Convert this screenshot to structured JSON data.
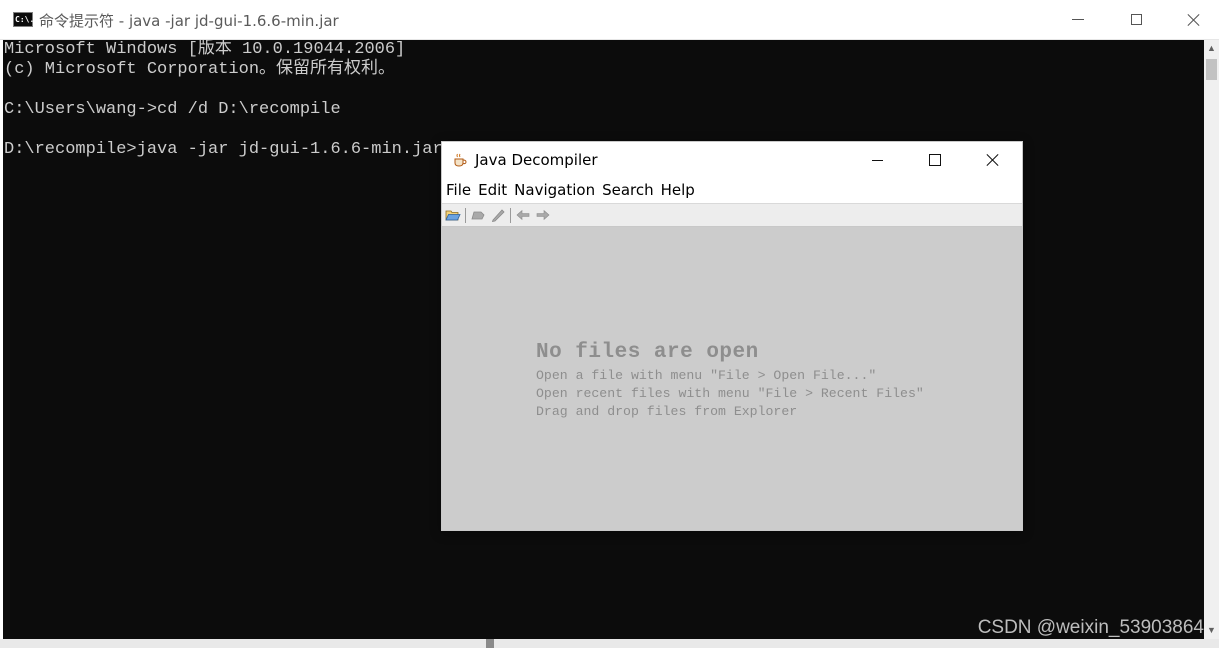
{
  "console_window": {
    "title": "命令提示符 - java  -jar jd-gui-1.6.6-min.jar",
    "icon": "cmd-icon",
    "icon_text": "C:\\.",
    "controls": {
      "minimize": "minimize-icon",
      "maximize": "maximize-icon",
      "close": "close-icon"
    },
    "lines": [
      "Microsoft Windows [版本 10.0.19044.2006]",
      "(c) Microsoft Corporation。保留所有权利。",
      "",
      "C:\\Users\\wang->cd /d D:\\recompile",
      "",
      "D:\\recompile>java -jar jd-gui-1.6.6-min.jar"
    ],
    "colors": {
      "background": "#0c0c0c",
      "text": "#cccccc"
    }
  },
  "watermark": "CSDN @weixin_53903864",
  "jd_window": {
    "title": "Java Decompiler",
    "icon": "coffee-cup-icon",
    "menu": [
      "File",
      "Edit",
      "Navigation",
      "Search",
      "Help"
    ],
    "toolbar": [
      "open-folder-icon",
      "open-type-icon",
      "search-pencil-icon",
      "back-arrow-icon",
      "forward-arrow-icon"
    ],
    "empty_state": {
      "title": "No files are open",
      "hints": [
        "Open a file with menu \"File > Open File...\"",
        "Open recent files with menu \"File > Recent Files\"",
        "Drag and drop files from Explorer"
      ]
    },
    "colors": {
      "content_bg": "#cccccc",
      "hint_text": "#8e8e8e"
    }
  }
}
